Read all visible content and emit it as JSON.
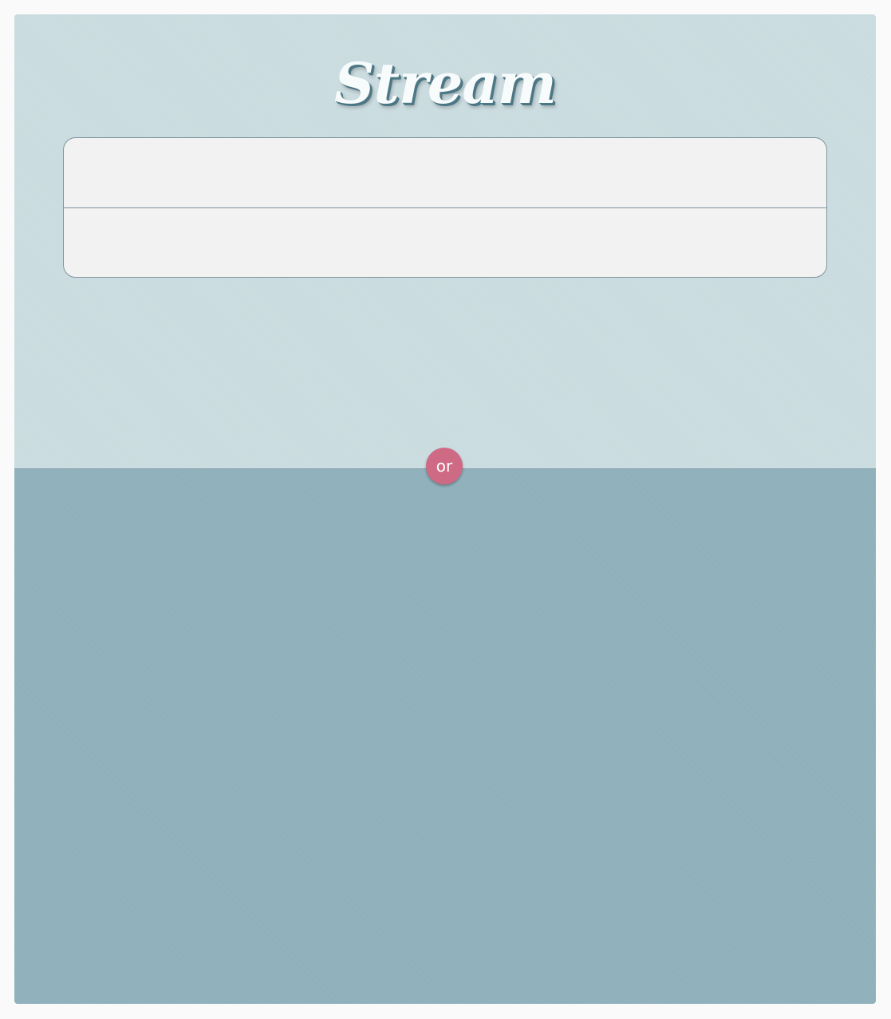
{
  "app": {
    "title": "Stream"
  },
  "login_form": {
    "username_value": "",
    "username_placeholder": "",
    "password_value": "",
    "password_placeholder": ""
  },
  "divider": {
    "label": "or"
  },
  "colors": {
    "top_panel": "#c9dbdf",
    "bottom_panel": "#8fb0bb",
    "badge": "#cf6a84",
    "input_background": "#f2f2f2"
  }
}
